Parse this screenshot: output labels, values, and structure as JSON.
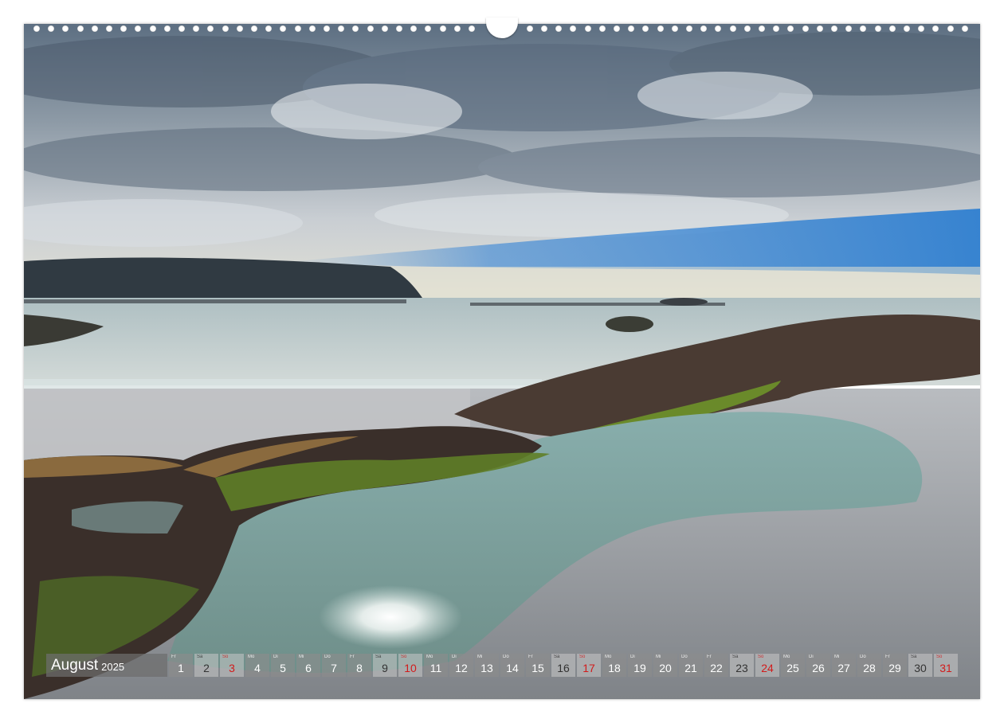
{
  "calendar": {
    "month": "August",
    "year": "2025",
    "days": [
      {
        "n": "1",
        "dow": "Fr",
        "type": "weekday"
      },
      {
        "n": "2",
        "dow": "Sa",
        "type": "weekend"
      },
      {
        "n": "3",
        "dow": "So",
        "type": "sunday"
      },
      {
        "n": "4",
        "dow": "Mo",
        "type": "weekday"
      },
      {
        "n": "5",
        "dow": "Di",
        "type": "weekday"
      },
      {
        "n": "6",
        "dow": "Mi",
        "type": "weekday"
      },
      {
        "n": "7",
        "dow": "Do",
        "type": "weekday"
      },
      {
        "n": "8",
        "dow": "Fr",
        "type": "weekday"
      },
      {
        "n": "9",
        "dow": "Sa",
        "type": "weekend"
      },
      {
        "n": "10",
        "dow": "So",
        "type": "sunday"
      },
      {
        "n": "11",
        "dow": "Mo",
        "type": "weekday"
      },
      {
        "n": "12",
        "dow": "Di",
        "type": "weekday"
      },
      {
        "n": "13",
        "dow": "Mi",
        "type": "weekday"
      },
      {
        "n": "14",
        "dow": "Do",
        "type": "weekday"
      },
      {
        "n": "15",
        "dow": "Fr",
        "type": "weekday"
      },
      {
        "n": "16",
        "dow": "Sa",
        "type": "weekend"
      },
      {
        "n": "17",
        "dow": "So",
        "type": "sunday"
      },
      {
        "n": "18",
        "dow": "Mo",
        "type": "weekday"
      },
      {
        "n": "19",
        "dow": "Di",
        "type": "weekday"
      },
      {
        "n": "20",
        "dow": "Mi",
        "type": "weekday"
      },
      {
        "n": "21",
        "dow": "Do",
        "type": "weekday"
      },
      {
        "n": "22",
        "dow": "Fr",
        "type": "weekday"
      },
      {
        "n": "23",
        "dow": "Sa",
        "type": "weekend"
      },
      {
        "n": "24",
        "dow": "So",
        "type": "sunday"
      },
      {
        "n": "25",
        "dow": "Mo",
        "type": "weekday"
      },
      {
        "n": "26",
        "dow": "Di",
        "type": "weekday"
      },
      {
        "n": "27",
        "dow": "Mi",
        "type": "weekday"
      },
      {
        "n": "28",
        "dow": "Do",
        "type": "weekday"
      },
      {
        "n": "29",
        "dow": "Fr",
        "type": "weekday"
      },
      {
        "n": "30",
        "dow": "Sa",
        "type": "weekend"
      },
      {
        "n": "31",
        "dow": "So",
        "type": "sunday"
      }
    ]
  },
  "colors": {
    "sunday": "#d21b1b",
    "sky_blue": "#2f7fd0",
    "water": "#8fb3b5",
    "rock": "#4a3b33",
    "moss": "#6a8a2a"
  }
}
